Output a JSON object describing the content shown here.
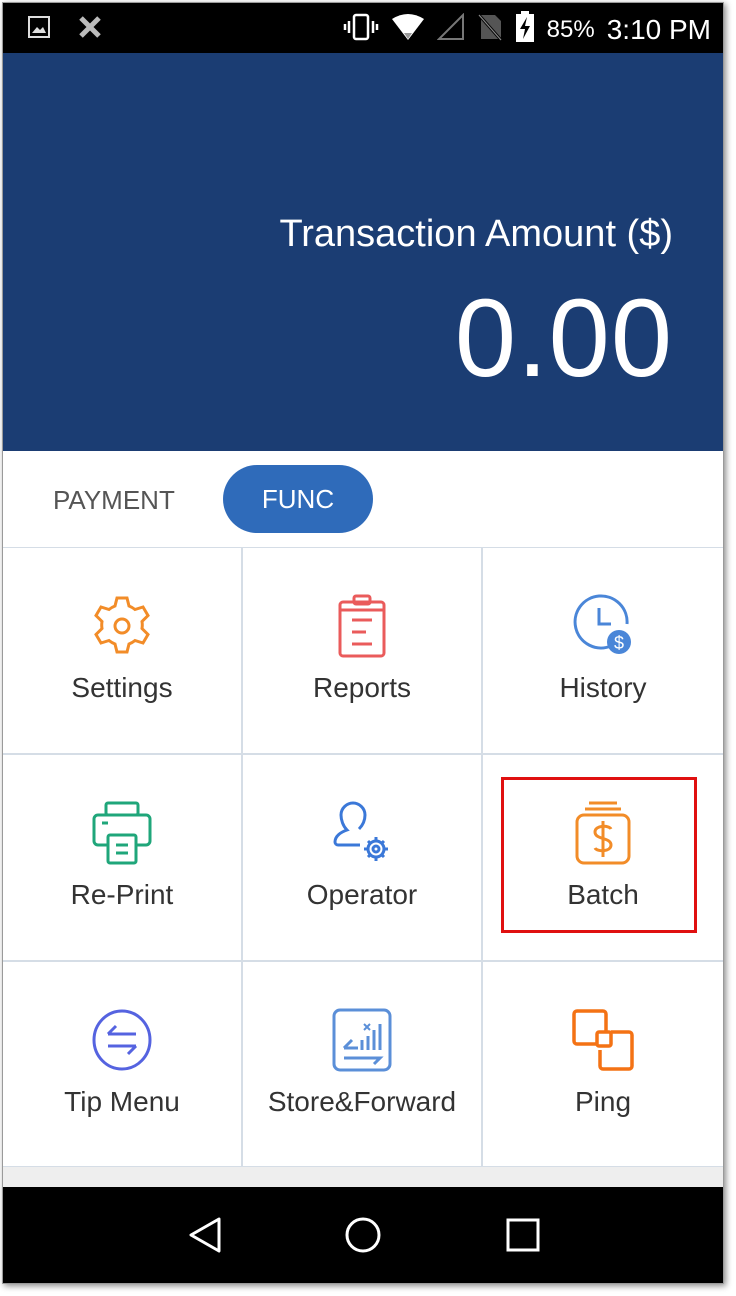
{
  "status_bar": {
    "left_icons": [
      "image-icon",
      "app-notification-icon"
    ],
    "right_icons": [
      "vibrate-icon",
      "wifi-icon",
      "signal-icon",
      "no-sim-icon",
      "battery-charging-icon"
    ],
    "battery": "85%",
    "time": "3:10 PM"
  },
  "header": {
    "amount_label": "Transaction Amount ($)",
    "amount_value": "0.00",
    "background_color": "#1b3d73"
  },
  "tabs": [
    {
      "label": "PAYMENT",
      "active": false
    },
    {
      "label": "FUNC",
      "active": true,
      "color": "#2f6bba"
    }
  ],
  "grid": [
    {
      "label": "Settings",
      "icon": "gear-icon",
      "color": "#f28c28"
    },
    {
      "label": "Reports",
      "icon": "clipboard-icon",
      "color": "#ea5b5b"
    },
    {
      "label": "History",
      "icon": "clock-dollar-icon",
      "color": "#4a86d8"
    },
    {
      "label": "Re-Print",
      "icon": "printer-icon",
      "color": "#1fa67a"
    },
    {
      "label": "Operator",
      "icon": "user-gear-icon",
      "color": "#3b78d8"
    },
    {
      "label": "Batch",
      "icon": "money-jar-icon",
      "color": "#f28c28",
      "highlighted": true
    },
    {
      "label": "Tip Menu",
      "icon": "swap-arrows-icon",
      "color": "#5563e0"
    },
    {
      "label": "Store&Forward",
      "icon": "store-forward-icon",
      "color": "#5b8fd8"
    },
    {
      "label": "Ping",
      "icon": "ping-squares-icon",
      "color": "#f47214"
    }
  ],
  "nav_bar": {
    "buttons": [
      "back-icon",
      "home-icon",
      "recents-icon"
    ]
  },
  "highlight_color": "#e01010"
}
